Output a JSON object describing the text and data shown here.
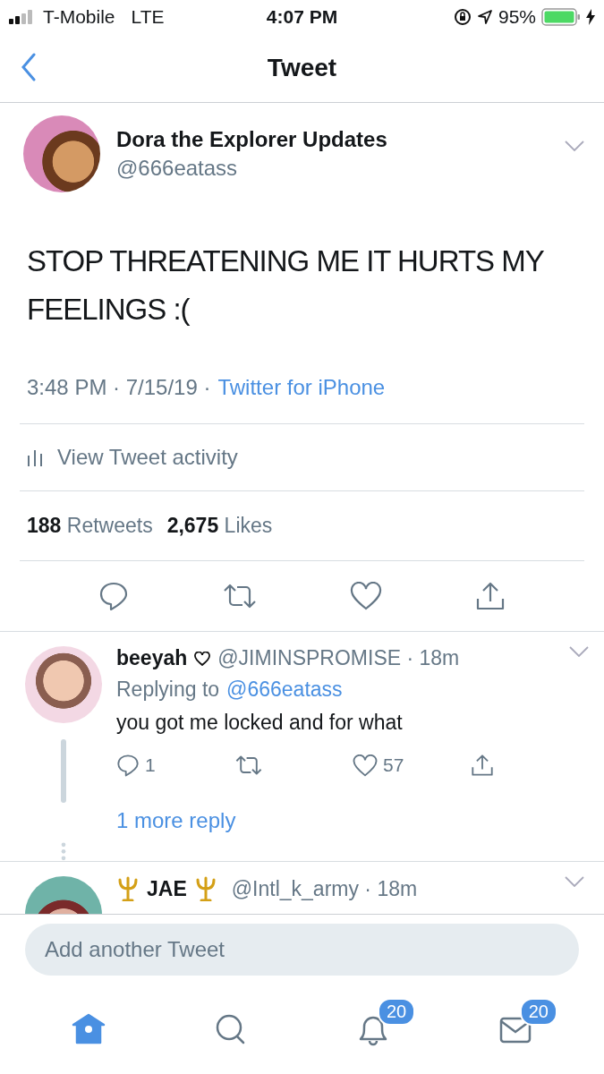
{
  "status_bar": {
    "carrier": "T-Mobile",
    "network": "LTE",
    "time": "4:07 PM",
    "battery": "95%"
  },
  "nav": {
    "title": "Tweet"
  },
  "tweet": {
    "name": "Dora the Explorer Updates",
    "handle": "@666eatass",
    "text": "STOP THREATENING ME IT HURTS MY FEELINGS :(",
    "time": "3:48 PM · 7/15/19 ·",
    "source": "Twitter for iPhone",
    "activity": "View Tweet activity",
    "retweets": "188",
    "retweets_label": "Retweets",
    "likes": "2,675",
    "likes_label": "Likes"
  },
  "replies": [
    {
      "name": "beeyah",
      "name_heart": true,
      "tridents": false,
      "handle": "@JIMINSPROMISE · 18m",
      "replying_prefix": "Replying to",
      "replying_to": "@666eatass",
      "text": "you got me locked and for what",
      "reply_count": "1",
      "like_count": "57",
      "more": "1 more reply"
    },
    {
      "name": "JAE",
      "name_heart": false,
      "tridents": true,
      "handle": "@Intl_k_army · 18m"
    }
  ],
  "compose": {
    "placeholder": "Add another Tweet"
  },
  "tabs": [
    {
      "kind": "home",
      "selected": true
    },
    {
      "kind": "search",
      "selected": false
    },
    {
      "kind": "notifications",
      "selected": false,
      "badge": "20"
    },
    {
      "kind": "messages",
      "selected": false,
      "badge": "20"
    }
  ]
}
